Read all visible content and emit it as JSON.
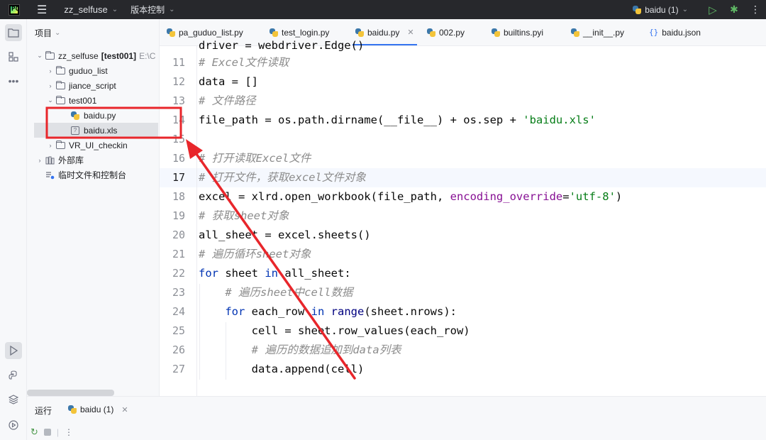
{
  "titlebar": {
    "project_name": "zz_selfuse",
    "vcs_label": "版本控制",
    "run_config": "baidu (1)"
  },
  "project_panel": {
    "title": "项目",
    "tree": [
      {
        "label": "zz_selfuse",
        "suffix": "[test001]",
        "path": "E:\\C",
        "icon": "folder-icon",
        "expanded": true
      },
      {
        "label": "guduo_list",
        "icon": "folder-icon",
        "expanded": false
      },
      {
        "label": "jiance_script",
        "icon": "folder-icon",
        "expanded": false
      },
      {
        "label": "test001",
        "icon": "folder-icon",
        "expanded": true
      },
      {
        "label": "baidu.py",
        "icon": "python-file-icon"
      },
      {
        "label": "baidu.xls",
        "icon": "unknown-file-icon",
        "selected": true
      },
      {
        "label": "VR_UI_checkin",
        "icon": "folder-icon",
        "expanded": false
      },
      {
        "label": "外部库",
        "icon": "library-icon",
        "expanded": false
      },
      {
        "label": "临时文件和控制台",
        "icon": "scratches-icon"
      }
    ]
  },
  "tabs": [
    {
      "label": "pa_guduo_list.py",
      "icon": "python-file-icon"
    },
    {
      "label": "test_login.py",
      "icon": "python-file-icon"
    },
    {
      "label": "baidu.py",
      "icon": "python-file-icon",
      "active": true
    },
    {
      "label": "002.py",
      "icon": "python-file-icon"
    },
    {
      "label": "builtins.pyi",
      "icon": "python-stub-icon"
    },
    {
      "label": "__init__.py",
      "icon": "python-file-icon"
    },
    {
      "label": "baidu.json",
      "icon": "json-file-icon"
    }
  ],
  "editor": {
    "current_line": 17,
    "lines": [
      {
        "no": "11",
        "text": "# Excel文件读取"
      },
      {
        "no": "12",
        "text": "data = []"
      },
      {
        "no": "13",
        "text": "# 文件路径"
      },
      {
        "no": "14",
        "text": "file_path = os.path.dirname(__file__) + os.sep + 'baidu.xls'"
      },
      {
        "no": "15",
        "text": ""
      },
      {
        "no": "16",
        "text": "# 打开读取Excel文件"
      },
      {
        "no": "17",
        "text": "# 打开文件，获取excel文件对象"
      },
      {
        "no": "18",
        "text": "excel = xlrd.open_workbook(file_path, encoding_override='utf-8')"
      },
      {
        "no": "19",
        "text": "# 获取sheet对象"
      },
      {
        "no": "20",
        "text": "all_sheet = excel.sheets()"
      },
      {
        "no": "21",
        "text": "# 遍历循环sheet对象"
      },
      {
        "no": "22",
        "text": "for sheet in all_sheet:"
      },
      {
        "no": "23",
        "text": "    # 遍历sheet中cell数据"
      },
      {
        "no": "24",
        "text": "    for each_row in range(sheet.nrows):"
      },
      {
        "no": "25",
        "text": "        cell = sheet.row_values(each_row)"
      },
      {
        "no": "26",
        "text": "        # 遍历的数据追加到data列表"
      },
      {
        "no": "27",
        "text": "        data.append(cell)"
      }
    ]
  },
  "bottom": {
    "run_label": "运行",
    "run_tab": "baidu (1)"
  },
  "colors": {
    "annotation_red": "#e8262b",
    "accent_blue": "#3574f0",
    "titlebar_bg": "#27282c"
  }
}
